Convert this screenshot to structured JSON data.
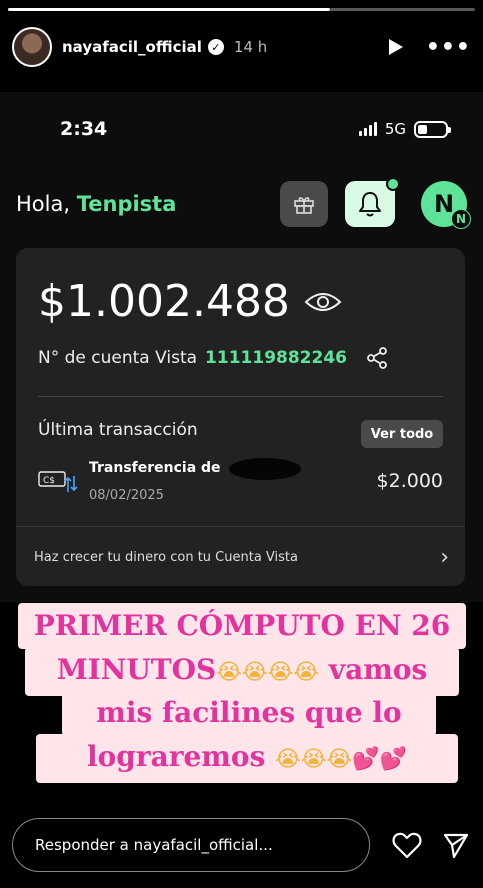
{
  "story": {
    "progress": 0.69,
    "username": "nayafacil_official",
    "time_ago": "14 h"
  },
  "phone": {
    "status": {
      "clock": "2:34",
      "network": "5G"
    },
    "greeting_prefix": "Hola,",
    "greeting_name": "Tenpista",
    "profile_initial": "N",
    "profile_sub_initial": "N",
    "account": {
      "balance": "$1.002.488",
      "account_label": "N° de cuenta Vista",
      "account_number": "111119882246",
      "last_tx_label": "Última transacción",
      "see_all": "Ver todo",
      "tx_title": "Transferencia de",
      "tx_date": "08/02/2025",
      "tx_amount": "$2.000",
      "grow_text": "Haz crecer tu dinero con tu Cuenta Vista"
    }
  },
  "caption": {
    "line1": "PRIMER CÓMPUTO EN 26",
    "line2_text": "MINUTOS",
    "line2_emoji": "😭😭😭😭",
    "line2_rest": " vamos",
    "line3": "mis facilines que lo",
    "line4_text": "lograremos ",
    "line4_emoji": "😭😭😭💕💕"
  },
  "reply": {
    "placeholder": "Responder a nayafacil_official..."
  },
  "colors": {
    "accent_green": "#5fe39a",
    "caption_pink": "#e2339e",
    "caption_bg": "#fde5e9"
  }
}
